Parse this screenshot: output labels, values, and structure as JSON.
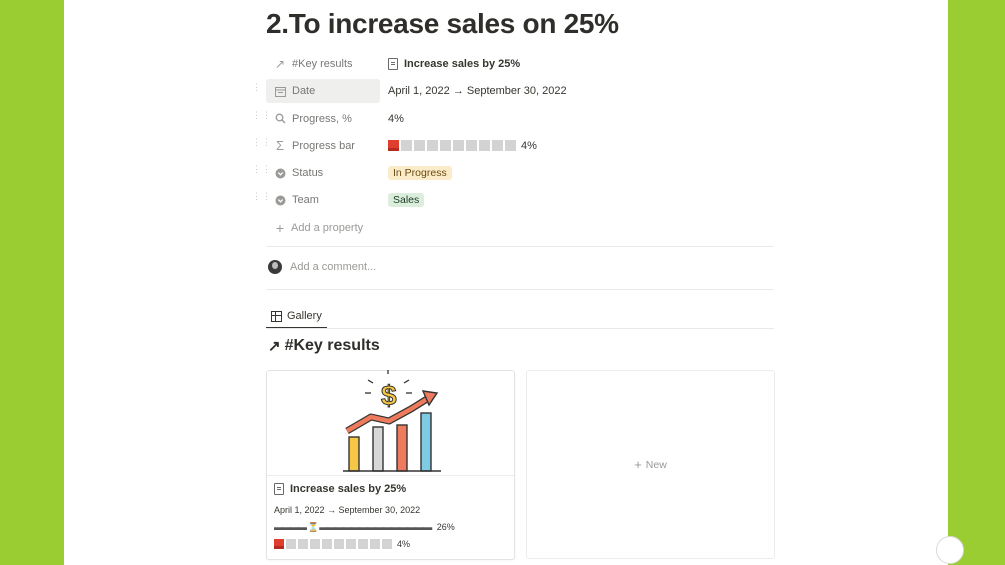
{
  "page": {
    "title": "2.To increase sales on 25%"
  },
  "properties": [
    {
      "name": "#Key results",
      "icon": "arrow-up-right-icon",
      "value": "Increase sales by 25%"
    },
    {
      "name": "Date",
      "icon": "calendar-icon",
      "value": "April 1, 2022 → September 30, 2022"
    },
    {
      "name": "Progress, %",
      "icon": "search-icon",
      "value": "4%"
    },
    {
      "name": "Progress bar",
      "icon": "sigma-icon",
      "value": "4%",
      "progress": 0.04,
      "filled": 1,
      "total": 10
    },
    {
      "name": "Status",
      "icon": "status-icon",
      "value": "In Progress"
    },
    {
      "name": "Team",
      "icon": "team-icon",
      "value": "Sales"
    }
  ],
  "add_property": "Add a property",
  "comment": {
    "placeholder": "Add a comment..."
  },
  "view": {
    "tab": "Gallery"
  },
  "section": {
    "title": "#Key results"
  },
  "gallery": {
    "card": {
      "title": "Increase sales by 25%",
      "date": "April 1, 2022 → September 30, 2022",
      "timeline": "▬▬▬▬ ⏳ ▬▬▬▬▬▬▬▬▬▬▬▬▬▬",
      "timeline_pct": "26%",
      "progress_pct": "4%",
      "progress": 0.04
    },
    "new_label": "New"
  },
  "colors": {
    "background": "#9acd32",
    "progress_fill": "#e03e2d",
    "status_tag": "#fbecc9",
    "team_tag": "#dbeddb"
  }
}
